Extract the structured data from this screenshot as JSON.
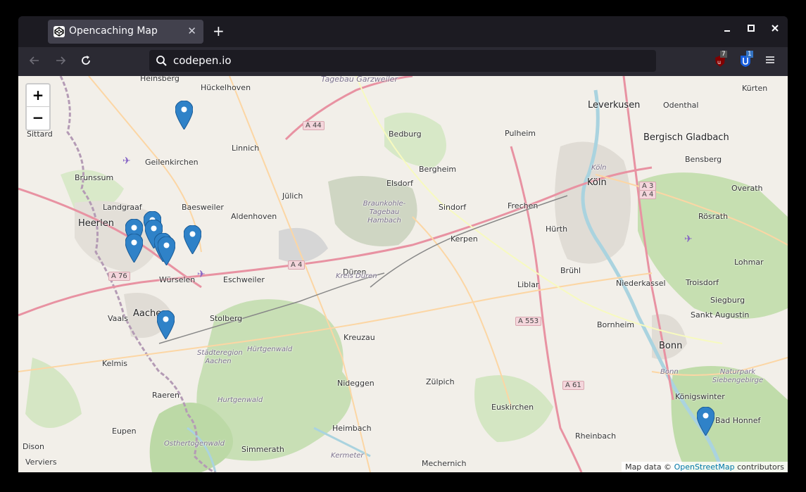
{
  "browser": {
    "tab_title": "Opencaching Map",
    "url": "codepen.io",
    "ublock_count": "7",
    "bitwarden_count": "1"
  },
  "map": {
    "zoom_in": "+",
    "zoom_out": "−",
    "cities": [
      {
        "name": "Heinsberg"
      },
      {
        "name": "Hückelhoven"
      },
      {
        "name": "Sittard"
      },
      {
        "name": "Geilenkirchen"
      },
      {
        "name": "Linnich"
      },
      {
        "name": "Brunssum"
      },
      {
        "name": "Landgraaf"
      },
      {
        "name": "Heerlen"
      },
      {
        "name": "Baesweiler"
      },
      {
        "name": "Aldenhoven"
      },
      {
        "name": "Jülich"
      },
      {
        "name": "Würselen"
      },
      {
        "name": "Eschweiler"
      },
      {
        "name": "Aachen"
      },
      {
        "name": "Vaals"
      },
      {
        "name": "Stolberg"
      },
      {
        "name": "Kelmis"
      },
      {
        "name": "Raeren"
      },
      {
        "name": "Eupen"
      },
      {
        "name": "Dison"
      },
      {
        "name": "Verviers"
      },
      {
        "name": "Simmerath"
      },
      {
        "name": "Bedburg"
      },
      {
        "name": "Pulheim"
      },
      {
        "name": "Bergheim"
      },
      {
        "name": "Elsdorf"
      },
      {
        "name": "Sindorf"
      },
      {
        "name": "Frechen"
      },
      {
        "name": "Kerpen"
      },
      {
        "name": "Hürth"
      },
      {
        "name": "Düren"
      },
      {
        "name": "Kreuzau"
      },
      {
        "name": "Nideggen"
      },
      {
        "name": "Zülpich"
      },
      {
        "name": "Heimbach"
      },
      {
        "name": "Mechernich"
      },
      {
        "name": "Euskirchen"
      },
      {
        "name": "Rheinbach"
      },
      {
        "name": "Liblar"
      },
      {
        "name": "Brühl"
      },
      {
        "name": "Bornheim"
      },
      {
        "name": "Niederkassel"
      },
      {
        "name": "Bonn"
      },
      {
        "name": "Königswinter"
      },
      {
        "name": "Bad Honnef"
      },
      {
        "name": "Troisdorf"
      },
      {
        "name": "Siegburg"
      },
      {
        "name": "Sankt Augustin"
      },
      {
        "name": "Lohmar"
      },
      {
        "name": "Rösrath"
      },
      {
        "name": "Overath"
      },
      {
        "name": "Bensberg"
      },
      {
        "name": "Bergisch Gladbach"
      },
      {
        "name": "Odenthal"
      },
      {
        "name": "Leverkusen"
      },
      {
        "name": "Kürten"
      },
      {
        "name": "Köln"
      },
      {
        "name": "Kerpen"
      }
    ],
    "big_cities": [
      "Köln",
      "Leverkusen",
      "Bergisch Gladbach",
      "Bonn",
      "Aachen",
      "Heerlen"
    ],
    "roads": [
      "A 44",
      "A 4",
      "A 76",
      "A 553",
      "A 61",
      "A 3",
      "A 4"
    ],
    "areas": [
      "Tagebau Garzweiler",
      "Braunkohle-Tagebau Hambach",
      "Kreis Düren",
      "Städteregion Aachen",
      "Hürtgenwald",
      "Hurtgenwald",
      "Osthertogenwald",
      "Naturpark Siebengebirge",
      "Kermeter",
      "Köln",
      "Bonn"
    ],
    "marker_color": "#2f82c8",
    "attribution_prefix": "Map data ©",
    "attribution_link": "OpenStreetMap",
    "attribution_suffix": "contributors"
  }
}
